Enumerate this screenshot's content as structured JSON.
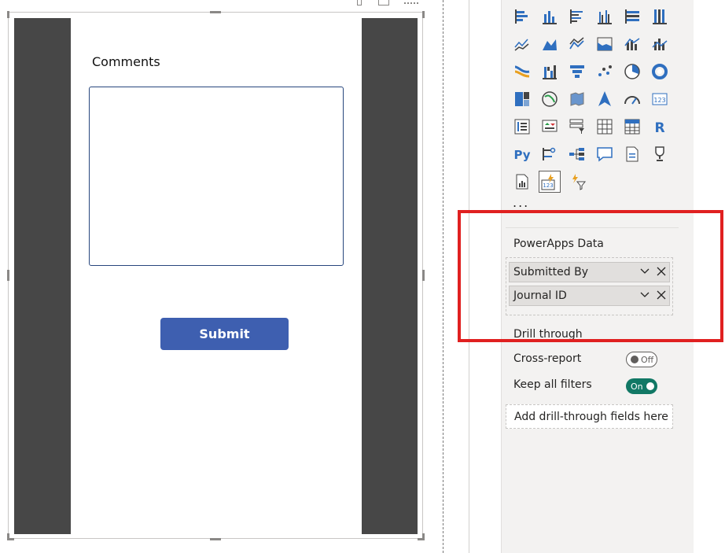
{
  "canvas": {
    "comments_label": "Comments",
    "comments_value": "",
    "submit_label": "Submit"
  },
  "viz_pane": {
    "icons": [
      "stacked-bar-chart-icon",
      "stacked-column-chart-icon",
      "clustered-bar-chart-icon",
      "clustered-column-chart-icon",
      "100-stacked-bar-chart-icon",
      "100-stacked-column-chart-icon",
      "line-chart-icon",
      "area-chart-icon",
      "stacked-area-chart-icon",
      "line-stacked-column-chart-icon",
      "line-clustered-column-chart-icon",
      "ribbon-chart-icon",
      "waterfall-chart-icon",
      "funnel-chart-icon",
      "scatter-chart-icon",
      "pie-chart-icon",
      "donut-chart-icon",
      "treemap-icon",
      "map-icon",
      "filled-map-icon",
      "azure-map-icon",
      "gauge-icon",
      "card-icon",
      "multi-row-card-icon",
      "kpi-icon",
      "slicer-icon",
      "table-icon",
      "matrix-icon",
      "r-script-visual-icon",
      "python-visual-icon",
      "key-influencers-icon",
      "decomposition-tree-icon",
      "qa-icon",
      "smart-narrative-icon",
      "paginated-report-icon",
      "metrics-icon",
      "power-automate-icon",
      "power-apps-icon",
      "more-visuals-icon"
    ],
    "more_label": "...",
    "wells": {
      "title": "PowerApps Data",
      "fields": [
        "Submitted By",
        "Journal ID"
      ]
    },
    "drill_through": {
      "title": "Drill through",
      "cross_report_label": "Cross-report",
      "cross_report_state": "Off",
      "keep_filters_label": "Keep all filters",
      "keep_filters_state": "On",
      "add_fields_placeholder": "Add drill-through fields here"
    }
  },
  "colors": {
    "submit_button": "#3e5fb0",
    "toggle_on": "#117865",
    "highlight": "#e02020",
    "chart_blue": "#2f6fbf",
    "chart_orange": "#e8a020"
  }
}
